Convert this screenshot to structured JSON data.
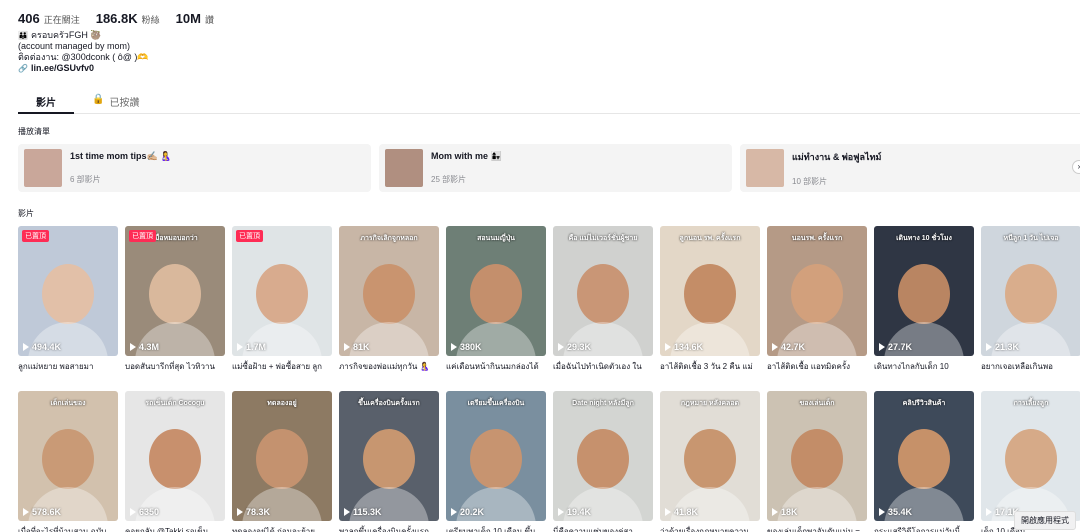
{
  "profile": {
    "stats": [
      {
        "value": "406",
        "label": "正在關注"
      },
      {
        "value": "186.8K",
        "label": "粉絲"
      },
      {
        "value": "10M",
        "label": "讚"
      }
    ],
    "bio_line1": "ครอบครัวFGH 🦥",
    "bio_line2": "(account managed by mom)",
    "bio_line3": "ติดต่องาน: @300dconk ( ô@ )🫶",
    "link": "lin.ee/GSUvfv0"
  },
  "tabs": [
    {
      "label": "影片",
      "active": true
    },
    {
      "label": "已按讚",
      "active": false
    }
  ],
  "playlists_heading": "播放清單",
  "playlists": [
    {
      "title": "1st time mom tips✍🏼 🤱",
      "count": "6 部影片",
      "color": "#c9a79a"
    },
    {
      "title": "Mom with me 👩‍👧",
      "count": "25 部影片",
      "color": "#b08f80"
    },
    {
      "title": "แม่ทำงาน & พ่อฟูลไทม์",
      "count": "10 部影片",
      "color": "#d7b8a6"
    }
  ],
  "videos_heading": "影片",
  "pinned_label": "已置頂",
  "videos": [
    {
      "views": "494.4K",
      "caption": "ลูกแม่หยาย พอสายมา",
      "pinned": true,
      "overlay": "",
      "bg": "#bfc9d8",
      "face": "#e2c0a8"
    },
    {
      "views": "4.3M",
      "caption": "บอดสันบารีกที่สุด ไวทิวาน",
      "pinned": true,
      "overlay": "เมื่อหมอบอกว่า",
      "bg": "#9a8b7a",
      "face": "#d9b89c"
    },
    {
      "views": "1.7M",
      "caption": "แม่ซื้อฝ้าย + พ่อซื้อสาย ลูก",
      "pinned": true,
      "overlay": "",
      "bg": "#dfe4e6",
      "face": "#d8ab8e"
    },
    {
      "views": "81K",
      "caption": "ภารกิจของพ่อแม่ทุกวัน 🤱",
      "pinned": false,
      "overlay": "ภารกิจเลิกจูกหลอก",
      "bg": "#c8b6a6",
      "face": "#c9946f"
    },
    {
      "views": "380K",
      "caption": "แค่เดือนหน้ากินนมกล่องได้",
      "pinned": false,
      "overlay": "สอนนมญี่ปุ่น",
      "bg": "#6e7f76",
      "face": "#c48f6c"
    },
    {
      "views": "29.3K",
      "caption": "เมื่อฉันไปทำเนิดตัวเอง ใน",
      "pinned": false,
      "overlay": "คือ แม่ไม่เวอร์ชั่นผู้ชาย",
      "bg": "#d0d1cf",
      "face": "#c99676"
    },
    {
      "views": "134.6K",
      "caption": "อาไส้ติดเชื้อ 3 วัน 2 คืน แม่",
      "pinned": false,
      "overlay": "ลูกนอน รพ. ครั้งแรก",
      "bg": "#e3d7c7",
      "face": "#c48d67"
    },
    {
      "views": "42.7K",
      "caption": "อาไส้ติดเชื้อ แอทมิดครั้ง",
      "pinned": false,
      "overlay": "นอนรพ. ครั้งแรก",
      "bg": "#b59a86",
      "face": "#d2a07c"
    },
    {
      "views": "27.7K",
      "caption": "เดินทางไกลกับเด็ก 10",
      "pinned": false,
      "overlay": "เดินทาง 10 ชั่วโมง",
      "bg": "#2f3644",
      "face": "#b98562"
    },
    {
      "views": "21.3K",
      "caption": "อยากเจอเหลือเกินพอ",
      "pinned": false,
      "overlay": "หนีลูก 1 วัน ไปเจอ",
      "bg": "#cfd6dd",
      "face": "#d9ad8c"
    },
    {
      "views": "578.6K",
      "caption": "เบื่อที่จะไรที่บ้านสวน ฉบับ",
      "pinned": false,
      "overlay": "เด็กเล่นของ",
      "bg": "#d2c1ad",
      "face": "#c99a76"
    },
    {
      "views": "6350",
      "caption": "คอยกลับ @Takki รอเข็น",
      "pinned": false,
      "overlay": "รถเข็นเด็ก Cocogu",
      "bg": "#e6e6e6",
      "face": "#c8906d"
    },
    {
      "views": "78.3K",
      "caption": "ทดลองอยู่ได้ ก่อนจะย้าย",
      "pinned": false,
      "overlay": "ทดลองอยู่",
      "bg": "#8d7a63",
      "face": "#c4926f"
    },
    {
      "views": "115.3K",
      "caption": "พาลูกขึ้นเครื่องบินครั้งแรก",
      "pinned": false,
      "overlay": "ขึ้นเครื่องบินครั้งแรก",
      "bg": "#59606b",
      "face": "#c79670"
    },
    {
      "views": "20.2K",
      "caption": "เตรียมพาเด็ก 10 เดือน ขึ้น",
      "pinned": false,
      "overlay": "เตรียมขึ้นเครื่องบิน",
      "bg": "#7a8f9f",
      "face": "#c79470"
    },
    {
      "views": "19.4K",
      "caption": "นี่คือความแซ่บของคู่สา",
      "pinned": false,
      "overlay": "Date night หลังมีลูก",
      "bg": "#d3d5d2",
      "face": "#c6916d"
    },
    {
      "views": "41.8K",
      "caption": "ว่าด้วยเรื่องกฎหมายความ",
      "pinned": false,
      "overlay": "กฎหมาย หลังคลอด",
      "bg": "#e1ddd6",
      "face": "#c89670"
    },
    {
      "views": "18K",
      "caption": "ของเล่นเด็กพาอันดับแม่ม =",
      "pinned": false,
      "overlay": "ของเล่นเด็ก",
      "bg": "#ccc2b3",
      "face": "#c38d68"
    },
    {
      "views": "35.4K",
      "caption": "กระแสรีวิดีโอการแม่วันนี้",
      "pinned": false,
      "overlay": "คลิปรีวิวสินค้า",
      "bg": "#3e4a5a",
      "face": "#c69169"
    },
    {
      "views": "17.1K",
      "caption": "เด็ก 10 เดือน",
      "pinned": false,
      "overlay": "การเลี้ยงลูก",
      "bg": "#e0e6ea",
      "face": "#d6aa88"
    }
  ],
  "floating_button": "開啟應用程式"
}
